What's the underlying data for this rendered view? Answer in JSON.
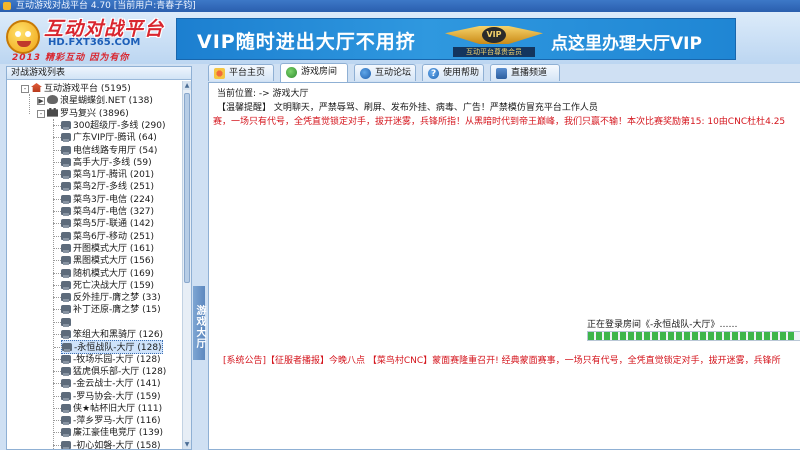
{
  "window": {
    "title": "互动游戏对战平台 4.70 [当前用户:青春子钧]"
  },
  "header": {
    "logo_title": "互动对战平台",
    "logo_url": "HD.FXT365.COM",
    "logo_slogan": "2013 精彩互动 因为有你",
    "banner_left": "VIP随时进出大厅不用挤",
    "banner_badge_caption": "互动平台尊贵会员",
    "banner_badge_mark": "VIP",
    "banner_right": "点这里办理大厅VIP"
  },
  "left_panel": {
    "title": "对战游戏列表",
    "tree": [
      {
        "label": "互动游戏平台 (5195)",
        "icon": "house-icon",
        "toggle": "-",
        "level": 0
      },
      {
        "label": "浪星蝴蝶剑.NET (138)",
        "icon": "bird-icon",
        "toggle": "▶",
        "level": 1
      },
      {
        "label": "罗马复兴 (3896)",
        "icon": "castle-icon",
        "toggle": "-",
        "level": 1
      },
      {
        "label": "300超级厅-多线 (290)",
        "icon": "room-icon",
        "level": 2
      },
      {
        "label": "广东VIP厅-腾讯 (64)",
        "icon": "room-icon",
        "level": 2
      },
      {
        "label": "电信线路专用厅 (54)",
        "icon": "room-icon",
        "level": 2
      },
      {
        "label": "高手大厅-多线 (59)",
        "icon": "room-icon",
        "level": 2
      },
      {
        "label": "菜鸟1厅-腾讯 (201)",
        "icon": "room-icon",
        "level": 2
      },
      {
        "label": "菜鸟2厅-多线 (251)",
        "icon": "room-icon",
        "level": 2
      },
      {
        "label": "菜鸟3厅-电信 (224)",
        "icon": "room-icon",
        "level": 2
      },
      {
        "label": "菜鸟4厅-电信 (327)",
        "icon": "room-icon",
        "level": 2
      },
      {
        "label": "菜鸟5厅-联通 (142)",
        "icon": "room-icon",
        "level": 2
      },
      {
        "label": "菜鸟6厅-移动 (251)",
        "icon": "room-icon",
        "level": 2
      },
      {
        "label": "开图模式大厅 (161)",
        "icon": "room-icon",
        "level": 2
      },
      {
        "label": "黑图模式大厅 (156)",
        "icon": "room-icon",
        "level": 2
      },
      {
        "label": "随机模式大厅 (169)",
        "icon": "room-icon",
        "level": 2
      },
      {
        "label": "死亡决战大厅 (159)",
        "icon": "room-icon",
        "level": 2
      },
      {
        "label": "反外挂厅-膺之梦 (33)",
        "icon": "room-icon",
        "level": 2
      },
      {
        "label": "补丁还原-膺之梦 (15)",
        "icon": "room-icon",
        "level": 2
      },
      {
        "label": "",
        "icon": "room-icon",
        "level": 2
      },
      {
        "label": "笨组大和黑骑厅 (126)",
        "icon": "room-icon",
        "level": 2
      },
      {
        "label": "-永恒战队-大厅 (128)",
        "icon": "room-icon",
        "level": 2,
        "selected": true
      },
      {
        "label": "-牧场乐园-大厅 (128)",
        "icon": "room-icon",
        "level": 2
      },
      {
        "label": "猛虎俱乐部-大厅 (128)",
        "icon": "room-icon",
        "level": 2
      },
      {
        "label": "-金云战士-大厅 (141)",
        "icon": "room-icon",
        "level": 2
      },
      {
        "label": "-罗马协会-大厅 (159)",
        "icon": "room-icon",
        "level": 2
      },
      {
        "label": "侠★帖杯旧大厅 (111)",
        "icon": "room-icon",
        "level": 2
      },
      {
        "label": "-萍乡罗马-大厅 (116)",
        "icon": "room-icon",
        "level": 2
      },
      {
        "label": "廉江豪佳电竞厅 (139)",
        "icon": "room-icon",
        "level": 2
      },
      {
        "label": "-初心如磐-大厅 (158)",
        "icon": "room-icon",
        "level": 2
      }
    ]
  },
  "side_tab": {
    "label": "游戏大厅"
  },
  "main": {
    "tabs": [
      {
        "label": "平台主页",
        "icon": "home-icon",
        "active": false
      },
      {
        "label": "游戏房间",
        "icon": "game-icon",
        "active": true
      },
      {
        "label": "互动论坛",
        "icon": "forum-icon",
        "active": false
      },
      {
        "label": "使用帮助",
        "icon": "help-icon",
        "active": false
      },
      {
        "label": "直播频道",
        "icon": "live-icon",
        "active": false
      }
    ],
    "location": "当前位置:   -> 游戏大厅",
    "notice": "【温馨提醒】 文明聊天，严禁辱骂、刷屏、发布外挂、病毒、广告！严禁模仿冒充平台工作人员",
    "marquee": "赛，一场只有代号，全凭直觉锁定对手，拔开迷雾，兵锋所指！从黑暗时代到帝王巅峰，我们只赢不输！本次比赛奖励第15: 10由CNC杜杜4.25",
    "loading_text": "正在登录房间《-永恒战队-大厅》……",
    "loading_progress": 0.98,
    "footer_ticker": "[系统公告]【征服者播报】今晚八点 【菜鸟村CNC】蒙面赛隆重召开! 经典蒙面赛事，一场只有代号，全凭直觉锁定对手，拔开迷雾，兵锋所"
  },
  "colors": {
    "accent_blue": "#1c7fd0",
    "alert_red": "#d4141c",
    "progress_green": "#3db54a"
  }
}
